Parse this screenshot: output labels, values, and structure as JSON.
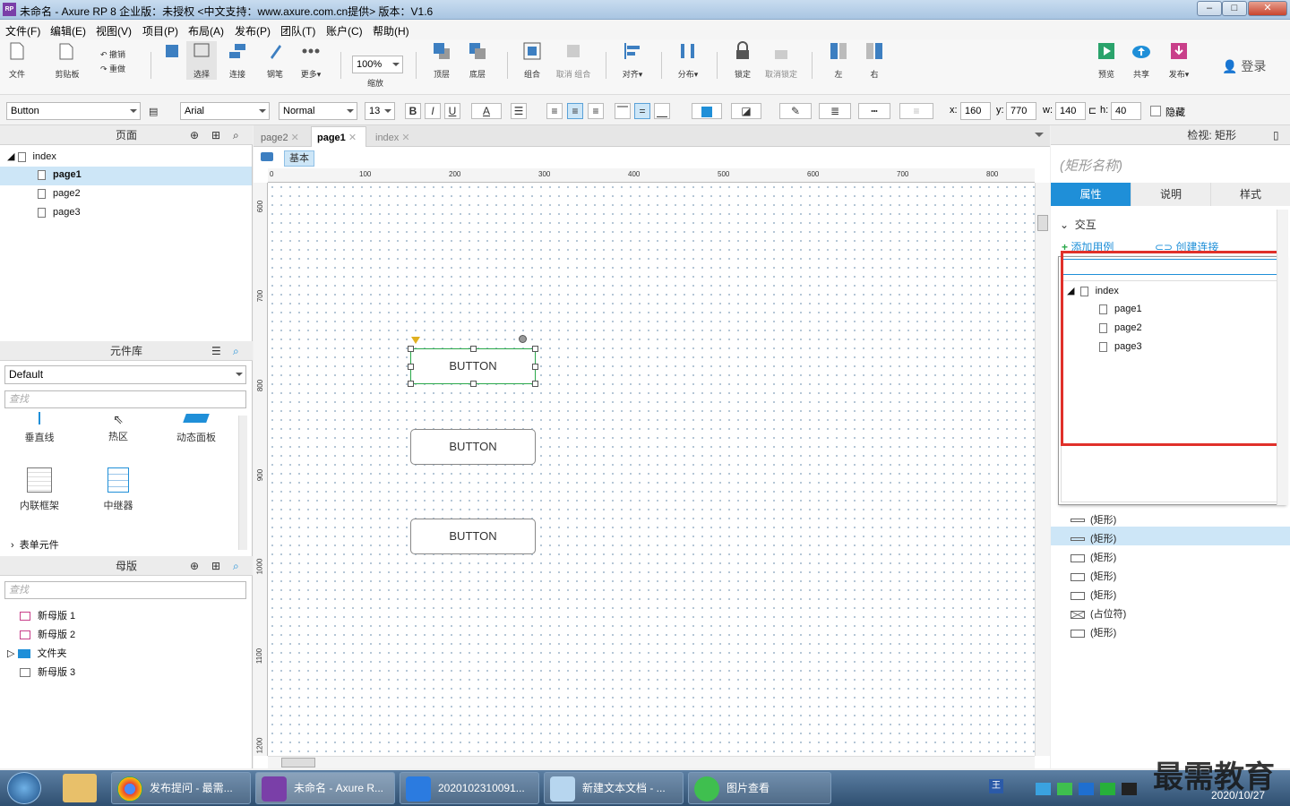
{
  "window": {
    "title": "未命名 - Axure RP 8 企业版：未授权      <中文支持：www.axure.com.cn提供> 版本：V1.6",
    "logo": "RP"
  },
  "menu": [
    "文件(F)",
    "编辑(E)",
    "视图(V)",
    "项目(P)",
    "布局(A)",
    "发布(P)",
    "团队(T)",
    "账户(C)",
    "帮助(H)"
  ],
  "toolbar": {
    "file": "文件",
    "clipboard": "剪贴板",
    "undo": "撤销",
    "redo": "重做",
    "select": "选择",
    "connect": "连接",
    "pen": "钢笔",
    "more": "更多▾",
    "zoom_value": "100%",
    "zoom_label": "缩放",
    "top": "顶层",
    "bottom": "底层",
    "group": "组合",
    "ungroup": "取消 组合",
    "align": "对齐▾",
    "distribute": "分布▾",
    "lock": "锁定",
    "unlock": "取消锁定",
    "left": "左",
    "right": "右",
    "preview": "预览",
    "share": "共享",
    "publish": "发布▾",
    "login": "登录"
  },
  "format": {
    "widget_type": "Button",
    "font": "Arial",
    "style": "Normal",
    "size": "13",
    "bold": "B",
    "italic": "I",
    "underline": "U",
    "font_color": "A",
    "x_label": "x:",
    "x": "160",
    "y_label": "y:",
    "y": "770",
    "w_label": "w:",
    "w": "140",
    "h_label": "h:",
    "h": "40",
    "hidden_label": "隐藏"
  },
  "pages_panel": {
    "title": "页面",
    "root": "index",
    "pages": [
      "page1",
      "page2",
      "page3"
    ]
  },
  "library_panel": {
    "title": "元件库",
    "selected_library": "Default",
    "search_placeholder": "查找",
    "items": [
      "垂直线",
      "热区",
      "动态面板",
      "内联框架",
      "中继器"
    ],
    "group": "表单元件"
  },
  "masters_panel": {
    "title": "母版",
    "search_placeholder": "查找",
    "items": [
      "新母版 1",
      "新母版 2",
      "文件夹",
      "新母版 3"
    ]
  },
  "tabs": [
    "page2",
    "page1",
    "index"
  ],
  "canvas": {
    "adaptive_label": "基本",
    "h_ruler": [
      "0",
      "100",
      "200",
      "300",
      "400",
      "500",
      "600",
      "700",
      "800"
    ],
    "v_ruler": [
      "600",
      "700",
      "800",
      "900",
      "1000",
      "1100",
      "1200"
    ],
    "buttons": [
      "BUTTON",
      "BUTTON",
      "BUTTON"
    ]
  },
  "inspector": {
    "title": "检视: 矩形",
    "shape_name_placeholder": "(矩形名称)",
    "tabs": [
      "属性",
      "说明",
      "样式"
    ],
    "section": "交互",
    "add_case": "添加用例",
    "create_link": "创建连接",
    "link_tree": {
      "root": "index",
      "pages": [
        "page1",
        "page2",
        "page3"
      ]
    }
  },
  "layers": [
    "(矩形)",
    "(矩形)",
    "(矩形)",
    "(矩形)",
    "(矩形)",
    "(占位符)",
    "(矩形)"
  ],
  "taskbar": {
    "items": [
      "发布提问 - 最需...",
      "未命名 - Axure R...",
      "2020102310091...",
      "新建文本文档 - ...",
      "图片查看"
    ],
    "date": "2020/10/27",
    "watermark": "最需教育"
  },
  "colors": {
    "accent": "#1f8fd8",
    "highlight_border": "#e0302a",
    "selection": "#cde6f7"
  }
}
